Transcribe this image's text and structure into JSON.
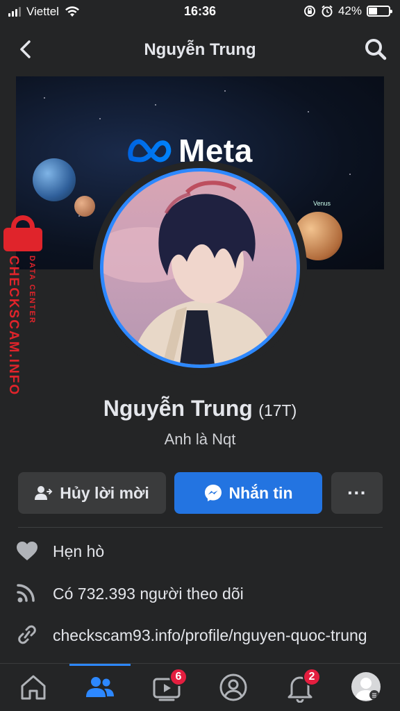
{
  "status_bar": {
    "carrier": "Viettel",
    "time": "16:36",
    "battery_percent": "42%",
    "battery_level": 0.42
  },
  "nav": {
    "title": "Nguyễn Trung",
    "back_icon": "chevron-left-icon",
    "search_icon": "search-icon"
  },
  "cover": {
    "brand": "Meta",
    "planet_label_1": "Venus"
  },
  "watermark": {
    "main": "CHECKSCAM.INFO",
    "sub": "DATA CENTER"
  },
  "profile": {
    "name": "Nguyễn Trung",
    "nickname": "(17T)",
    "bio": "Anh là Nqt"
  },
  "actions": {
    "cancel_request_label": "Hủy lời mời",
    "message_label": "Nhắn tin",
    "more_label": "···"
  },
  "info": {
    "dating": "Hẹn hò",
    "followers": "Có 732.393 người theo dõi",
    "link": "checkscam93.info/profile/nguyen-quoc-trung"
  },
  "tabs": {
    "watch_badge": "6",
    "notifications_badge": "2"
  },
  "colors": {
    "accent": "#2d88ff",
    "message_button": "#2374e1",
    "badge": "#e41e3f",
    "background": "#242526",
    "watermark": "#e0242b"
  }
}
